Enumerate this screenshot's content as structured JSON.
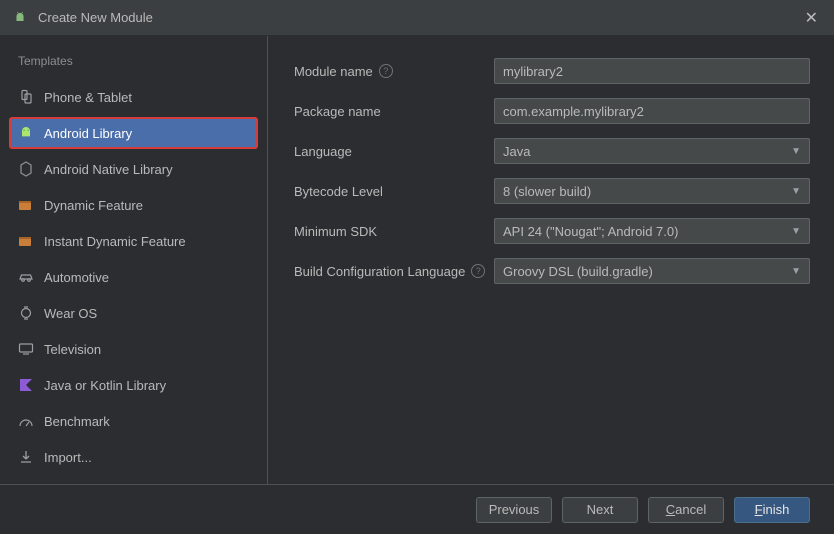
{
  "window": {
    "title": "Create New Module"
  },
  "sidebar": {
    "header": "Templates",
    "items": [
      {
        "label": "Phone & Tablet"
      },
      {
        "label": "Android Library"
      },
      {
        "label": "Android Native Library"
      },
      {
        "label": "Dynamic Feature"
      },
      {
        "label": "Instant Dynamic Feature"
      },
      {
        "label": "Automotive"
      },
      {
        "label": "Wear OS"
      },
      {
        "label": "Television"
      },
      {
        "label": "Java or Kotlin Library"
      },
      {
        "label": "Benchmark"
      }
    ],
    "import_label": "Import..."
  },
  "form": {
    "module_name": {
      "label": "Module name",
      "value": "mylibrary2"
    },
    "package_name": {
      "label": "Package name",
      "value": "com.example.mylibrary2"
    },
    "language": {
      "label": "Language",
      "value": "Java"
    },
    "bytecode_level": {
      "label": "Bytecode Level",
      "value": "8 (slower build)"
    },
    "minimum_sdk": {
      "label": "Minimum SDK",
      "value": "API 24 (\"Nougat\"; Android 7.0)"
    },
    "build_config": {
      "label": "Build Configuration Language",
      "value": "Groovy DSL (build.gradle)"
    }
  },
  "footer": {
    "previous": "Previous",
    "next": "Next",
    "cancel_pre": "",
    "cancel_m": "C",
    "cancel_post": "ancel",
    "finish_pre": "",
    "finish_m": "F",
    "finish_post": "inish"
  }
}
